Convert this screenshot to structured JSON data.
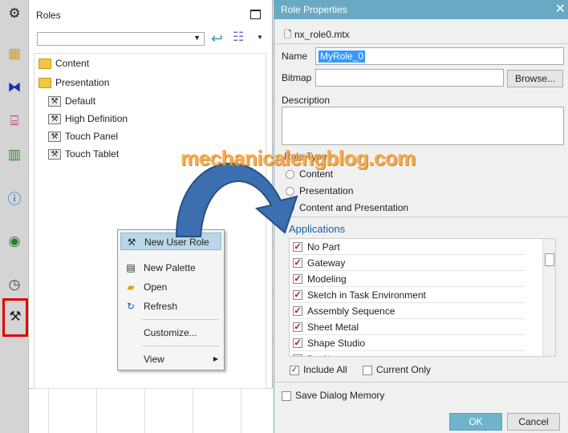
{
  "rail": {
    "icons": [
      "gear-icon",
      "assembly-navigator-icon",
      "constraint-navigator-icon",
      "part-navigator-icon",
      "reuse-library-icon",
      "info-icon",
      "web-browser-icon",
      "history-icon",
      "roles-icon"
    ]
  },
  "nav": {
    "title": "Roles",
    "combo_value": "",
    "tree": [
      {
        "label": "Content",
        "type": "folder",
        "level": 0
      },
      {
        "label": "Presentation",
        "type": "folder-open",
        "level": 0
      },
      {
        "label": "Default",
        "type": "role",
        "level": 1
      },
      {
        "label": "High Definition",
        "type": "role",
        "level": 1
      },
      {
        "label": "Touch Panel",
        "type": "role",
        "level": 1
      },
      {
        "label": "Touch Tablet",
        "type": "role",
        "level": 1
      }
    ]
  },
  "menu": {
    "items": [
      {
        "label": "New User Role",
        "icon": "role-icon",
        "highlighted": true
      },
      {
        "label": "New Palette",
        "icon": "palette-icon"
      },
      {
        "label": "Open",
        "icon": "open-folder-icon"
      },
      {
        "label": "Refresh",
        "icon": "refresh-icon"
      },
      {
        "label": "Customize..."
      },
      {
        "label": "View",
        "submenu": true
      }
    ]
  },
  "watermark": "mechanicalengblog.com",
  "dialog": {
    "title": "Role Properties",
    "file": "nx_role0.mtx",
    "name_label": "Name",
    "name_value": "MyRole_0",
    "bitmap_label": "Bitmap",
    "bitmap_value": "",
    "browse": "Browse...",
    "description_label": "Description",
    "description_value": "",
    "role_type_label": "Role Type",
    "role_types": [
      "Content",
      "Presentation",
      "Content and Presentation"
    ],
    "applications_label": "Applications",
    "applications": [
      "No Part",
      "Gateway",
      "Modeling",
      "Sketch in Task Environment",
      "Assembly Sequence",
      "Sheet Metal",
      "Shape Studio",
      "Drafting"
    ],
    "include_all": "Include All",
    "include_all_checked": true,
    "current_only": "Current Only",
    "current_only_checked": false,
    "save_memory": "Save Dialog Memory",
    "save_memory_checked": false,
    "ok": "OK",
    "cancel": "Cancel"
  },
  "colors": {
    "title_bar": "#69a9c4",
    "highlight": "#3399ff",
    "check": "#cc0000",
    "watermark": "#f4a030",
    "arrow": "#3b6fb0",
    "rail_highlight": "#e00000"
  }
}
